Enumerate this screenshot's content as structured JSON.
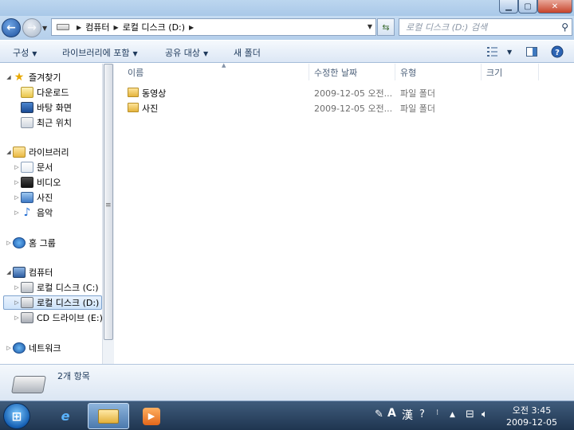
{
  "window": {
    "controls": {
      "minimize": "▁",
      "maximize": "▢",
      "close": "✕"
    }
  },
  "address": {
    "segments": [
      "컴퓨터",
      "로컬 디스크 (D:)"
    ],
    "search_placeholder": "로컬 디스크 (D:) 검색"
  },
  "toolbar": {
    "organize": "구성",
    "include_library": "라이브러리에 포함",
    "share": "공유 대상",
    "new_folder": "새 폴더"
  },
  "nav": {
    "favorites": "즐겨찾기",
    "downloads": "다운로드",
    "desktop": "바탕 화면",
    "recent": "최근 위치",
    "libraries": "라이브러리",
    "documents": "문서",
    "videos": "비디오",
    "pictures": "사진",
    "music": "음악",
    "homegroup": "홈 그룹",
    "computer": "컴퓨터",
    "drive_c": "로컬 디스크 (C:)",
    "drive_d": "로컬 디스크 (D:)",
    "drive_e": "CD 드라이브 (E:)",
    "network": "네트워크"
  },
  "columns": {
    "name": "이름",
    "date": "수정한 날짜",
    "type": "유형",
    "size": "크기"
  },
  "files": [
    {
      "name": "동영상",
      "date": "2009-12-05 오전...",
      "type": "파일 폴더"
    },
    {
      "name": "사진",
      "date": "2009-12-05 오전...",
      "type": "파일 폴더"
    }
  ],
  "details": {
    "item_count": "2개 항목"
  },
  "taskbar": {
    "ime_mode": "A",
    "ime_hanja": "漢",
    "time": "오전 3:45",
    "date": "2009-12-05"
  }
}
